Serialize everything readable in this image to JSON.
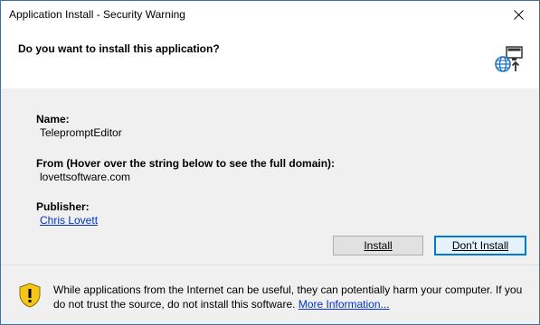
{
  "window": {
    "title": "Application Install - Security Warning",
    "close_glyph": "✕"
  },
  "header": {
    "question": "Do you want to install this application?",
    "icon": "network-install-icon"
  },
  "details": {
    "name_label": "Name:",
    "name_value": "TelepromptEditor",
    "from_label": "From (Hover over the string below to see the full domain):",
    "from_value": "lovettsoftware.com",
    "publisher_label": "Publisher:",
    "publisher_value": "Chris Lovett"
  },
  "buttons": {
    "install": "Install",
    "dont_install": "Don't Install"
  },
  "footer": {
    "icon": "shield-warning-icon",
    "warning_text": "While applications from the Internet can be useful, they can potentially harm your computer. If you do not trust the source, do not install this software.",
    "more_info_link": "More Information..."
  },
  "colors": {
    "accent": "#0078d7",
    "link": "#0033cc",
    "shield_yellow": "#f5c518"
  }
}
